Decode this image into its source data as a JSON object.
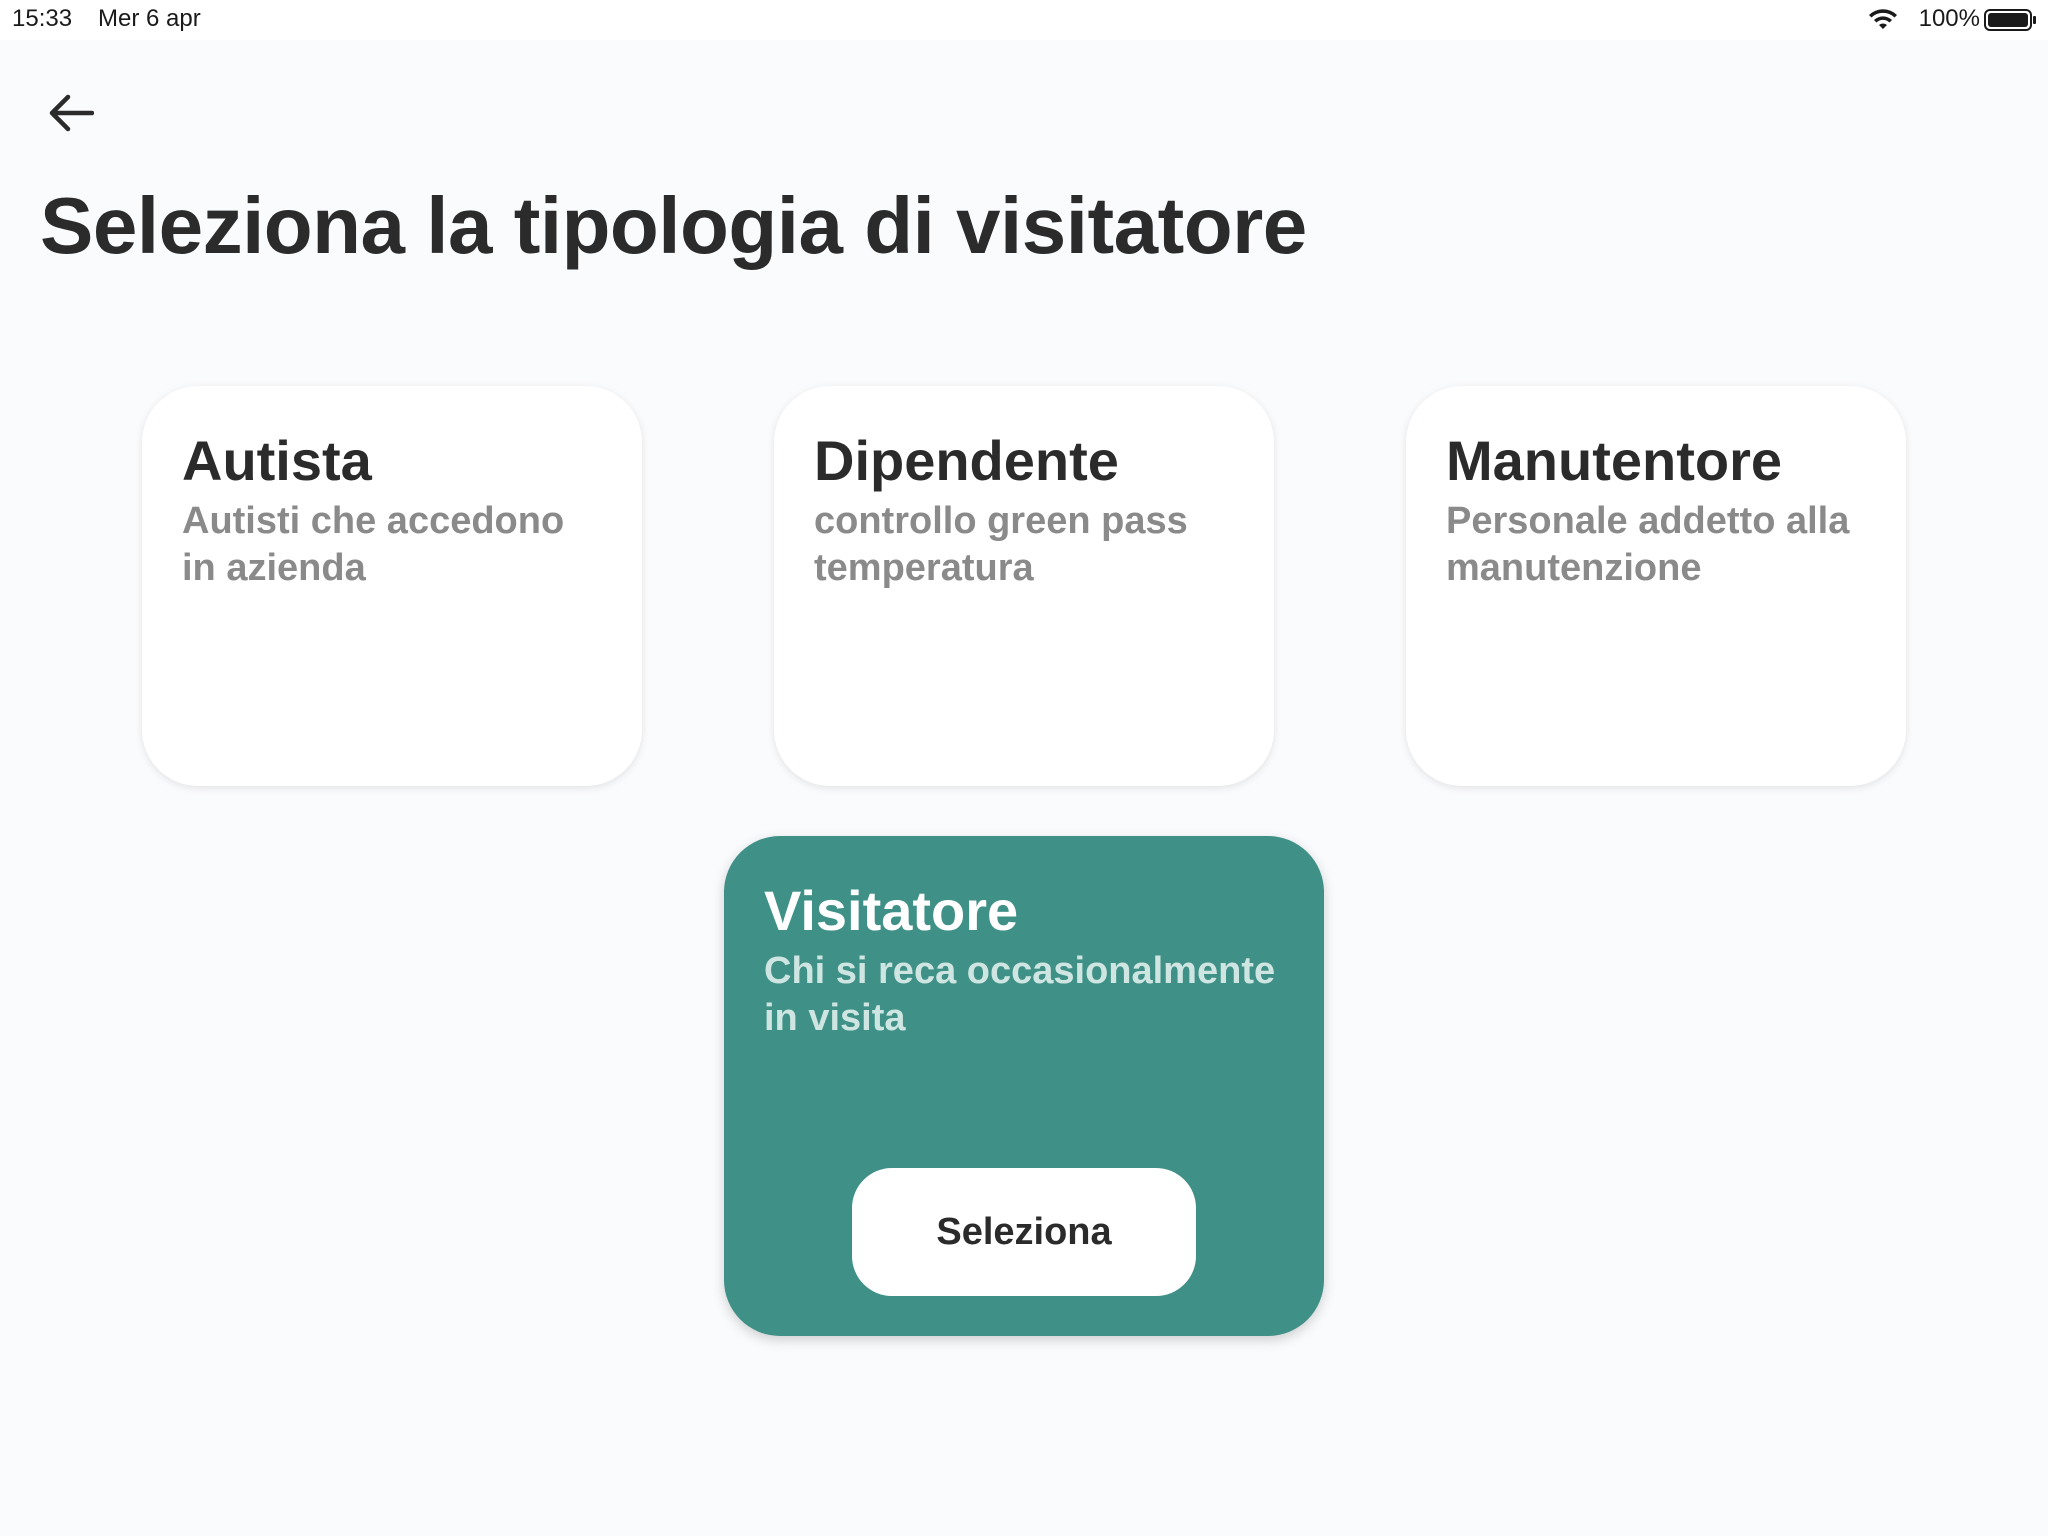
{
  "status_bar": {
    "time": "15:33",
    "date": "Mer 6 apr",
    "battery_percent": "100%"
  },
  "header": {
    "back_icon": "arrow-left-icon",
    "title": "Seleziona la tipologia di visitatore"
  },
  "cards": [
    {
      "title": "Autista",
      "description": "Autisti che accedono in azienda"
    },
    {
      "title": "Dipendente",
      "description": "controllo green pass temperatura"
    },
    {
      "title": "Manutentore",
      "description": "Personale addetto alla manutenzione"
    },
    {
      "title": "Visitatore",
      "description": "Chi si reca occasionalmente in visita",
      "selected": true,
      "button_label": "Seleziona"
    }
  ],
  "colors": {
    "background": "#fafbfd",
    "card": "#ffffff",
    "selected_card": "#3f9187",
    "title_text": "#2b2b2b",
    "description_text": "#8a8a8a"
  }
}
